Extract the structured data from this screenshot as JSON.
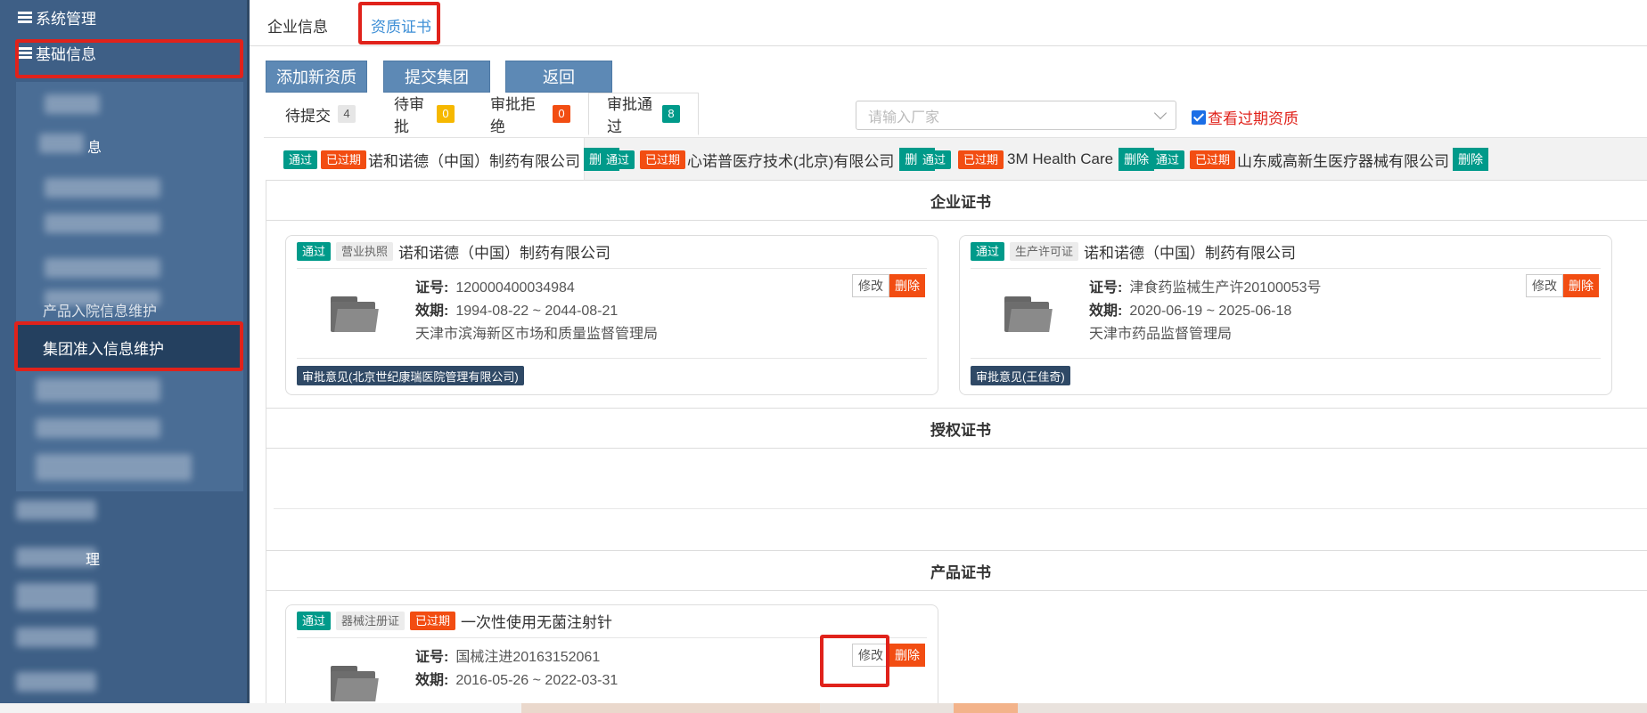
{
  "sidebar": {
    "system_mgmt": "系统管理",
    "basic_info": "基础信息",
    "sub_visible_1": "息",
    "sub_visible_2": "产品入院信息维护",
    "active_item": "集团准入信息维护",
    "sub_visible_3": "理"
  },
  "topnav": {
    "tab_company": "企业信息",
    "tab_qualification": "资质证书"
  },
  "toolbar": {
    "add_label": "添加新资质",
    "submit_label": "提交集团",
    "back_label": "返回"
  },
  "status_tabs": [
    {
      "label": "待提交",
      "count": "4"
    },
    {
      "label": "待审批",
      "count": "0"
    },
    {
      "label": "审批拒绝",
      "count": "0"
    },
    {
      "label": "审批通过",
      "count": "8"
    }
  ],
  "filter": {
    "vendor_placeholder": "请输入厂家",
    "show_expired_label": "查看过期资质",
    "show_expired_checked": true
  },
  "company_tabs": [
    {
      "status": "通过",
      "expired": "已过期",
      "name": "诺和诺德（中国）制药有限公司",
      "delete": "删除"
    },
    {
      "status": "通过",
      "expired": "已过期",
      "name": "心诺普医疗技术(北京)有限公司",
      "delete": "删除"
    },
    {
      "status": "通过",
      "expired": "已过期",
      "name": "3M Health Care",
      "delete": "删除"
    },
    {
      "status": "通过",
      "expired": "已过期",
      "name": "山东威高新生医疗器械有限公司",
      "delete": "删除"
    }
  ],
  "sections": {
    "enterprise": "企业证书",
    "authorization": "授权证书",
    "product": "产品证书"
  },
  "labels": {
    "cert_no": "证号:",
    "validity": "效期:",
    "edit": "修改",
    "delete": "删除"
  },
  "enterprise_certs": [
    {
      "status": "通过",
      "type": "营业执照",
      "company": "诺和诺德（中国）制药有限公司",
      "cert_no": "120000400034984",
      "validity": "1994-08-22 ~ 2044-08-21",
      "issuer": "天津市滨海新区市场和质量监督管理局",
      "opinion": "审批意见(北京世纪康瑞医院管理有限公司)"
    },
    {
      "status": "通过",
      "type": "生产许可证",
      "company": "诺和诺德（中国）制药有限公司",
      "cert_no": "津食药监械生产许20100053号",
      "validity": "2020-06-19 ~ 2025-06-18",
      "issuer": "天津市药品监督管理局",
      "opinion": "审批意见(王佳奇)"
    }
  ],
  "product_certs": [
    {
      "status": "通过",
      "type": "器械注册证",
      "expired": "已过期",
      "product": "一次性使用无菌注射针",
      "cert_no": "国械注进20163152061",
      "validity": "2016-05-26 ~ 2022-03-31"
    }
  ],
  "colors": {
    "sidebar_bg": "#3e5f86",
    "accent_blue": "#3e8fd6",
    "pass_teal": "#009a8a",
    "expired_orange": "#f24d12",
    "highlight_red": "#e0221b"
  }
}
